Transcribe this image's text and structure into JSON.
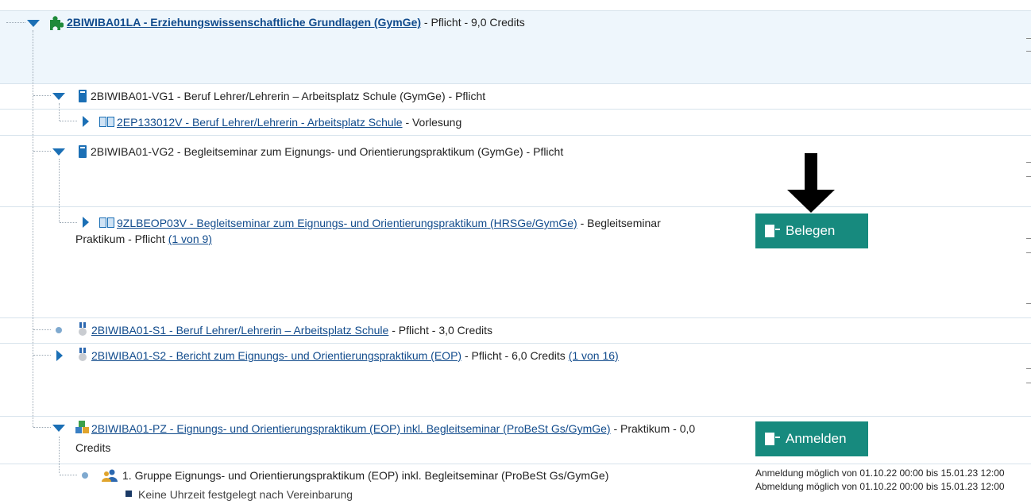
{
  "tree": {
    "root": {
      "code_title": "2BIWIBA01LA - Erziehungswissenschaftliche Grundlagen (GymGe)",
      "suffix": "- Pflicht - 9,0 Credits",
      "icon": "puzzle-icon"
    },
    "vg1": {
      "title": "2BIWIBA01-VG1 - Beruf Lehrer/Lehrerin – Arbeitsplatz Schule (GymGe) - Pflicht",
      "child": {
        "link": "2EP133012V - Beruf Lehrer/Lehrerin - Arbeitsplatz Schule",
        "suffix": "- Vorlesung"
      }
    },
    "vg2": {
      "title": "2BIWIBA01-VG2 - Begleitseminar zum Eignungs- und Orientierungspraktikum (GymGe) - Pflicht",
      "child": {
        "link": "9ZLBEOP03V - Begleitseminar zum Eignungs- und Orientierungspraktikum (HRSGe/GymGe)",
        "suffix": "- Begleitseminar",
        "line2": "Praktikum - Pflicht",
        "count": "(1 von 9)",
        "button": "Belegen"
      }
    },
    "s1": {
      "link": "2BIWIBA01-S1 - Beruf Lehrer/Lehrerin – Arbeitsplatz Schule",
      "suffix": "- Pflicht - 3,0 Credits"
    },
    "s2": {
      "link": "2BIWIBA01-S2 - Bericht zum Eignungs- und Orientierungspraktikum (EOP)",
      "suffix": "- Pflicht - 6,0 Credits",
      "count": "(1 von 16)"
    },
    "pz": {
      "link": "2BIWIBA01-PZ - Eignungs- und Orientierungspraktikum (EOP) inkl. Begleitseminar (ProBeSt Gs/GymGe)",
      "suffix": "- Praktikum - 0,0",
      "line2": "Credits",
      "button": "Anmelden",
      "group": {
        "title": "1. Gruppe Eignungs- und Orientierungspraktikum (EOP) inkl. Begleitseminar (ProBeSt Gs/GymGe)",
        "note": "Keine Uhrzeit festgelegt nach Vereinbarung",
        "anmeldung": "Anmeldung möglich von 01.10.22 00:00 bis 15.01.23 12:00",
        "abmeldung": "Abmeldung möglich von 01.10.22 00:00 bis 15.01.23 12:00"
      }
    }
  },
  "colors": {
    "accent": "#178a7e",
    "link": "#114b8c",
    "tree_icon": "#1b6fb5"
  }
}
